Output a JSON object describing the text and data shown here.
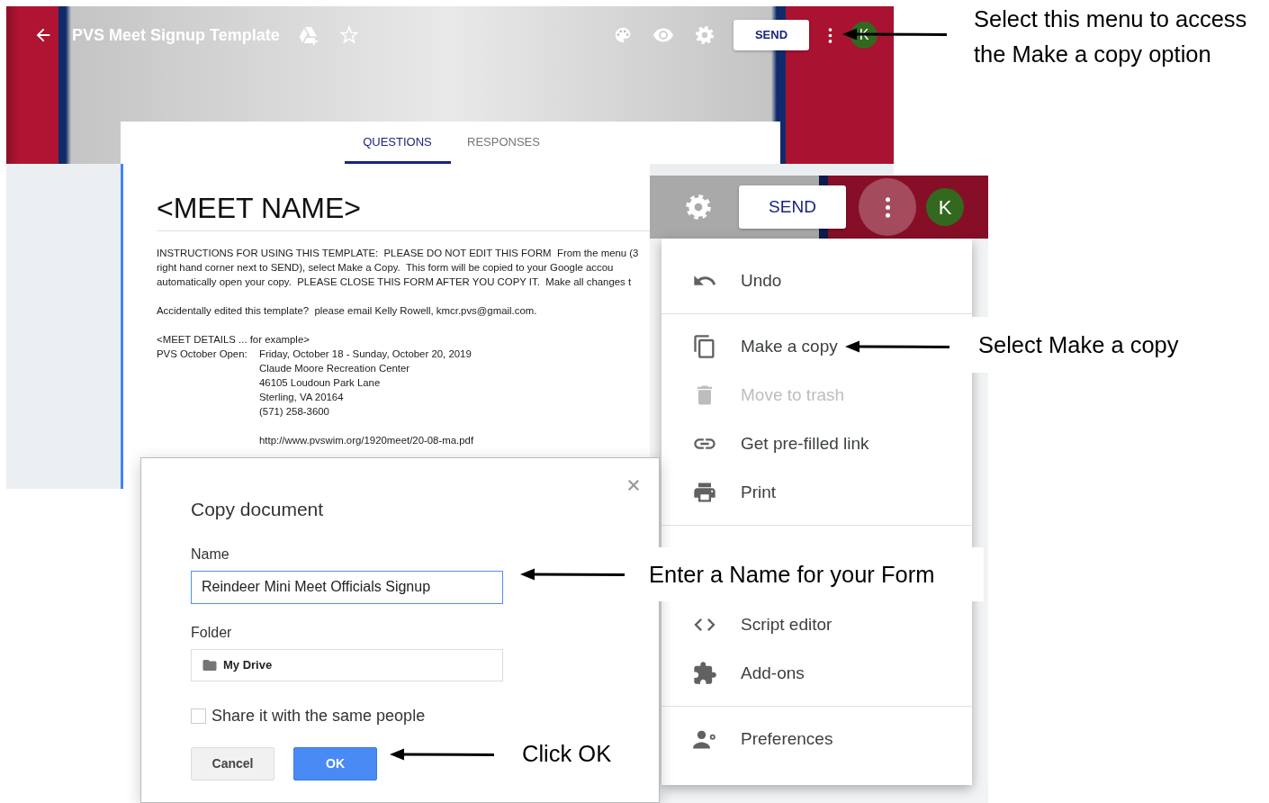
{
  "editor": {
    "title": "PVS Meet Signup Template",
    "send_button": "SEND",
    "avatar": "K",
    "tabs": [
      {
        "label": "QUESTIONS",
        "selected": true
      },
      {
        "label": "RESPONSES",
        "selected": false
      }
    ],
    "form": {
      "title": "<MEET NAME>",
      "instructions": [
        "INSTRUCTIONS FOR USING THIS TEMPLATE:  PLEASE DO NOT EDIT THIS FORM  From the menu (3",
        "right hand corner next to SEND), select Make a Copy.  This form will be copied to your Google accou",
        "automatically open your copy.  PLEASE CLOSE THIS FORM AFTER YOU COPY IT.  Make all changes t"
      ],
      "contact": "Accidentally edited this template?  please email Kelly Rowell, kmcr.pvs@gmail.com.",
      "details_heading": "<MEET DETAILS ... for example>",
      "details": [
        {
          "label": "PVS October Open:",
          "lines": [
            "Friday, October 18 - Sunday, October 20, 2019",
            "Claude Moore Recreation Center",
            "46105 Loudoun Park Lane",
            "Sterling, VA 20164",
            "(571) 258-3600"
          ]
        }
      ],
      "link": "http://www.pvswim.org/1920meet/20-08-ma.pdf"
    }
  },
  "menu_view": {
    "send_button": "SEND",
    "avatar": "K",
    "menu_button_active": true,
    "menu": {
      "groups": [
        {
          "items": [
            {
              "label": "Undo",
              "disabled": false
            }
          ]
        },
        {
          "items": [
            {
              "label": "Make a copy",
              "disabled": false
            },
            {
              "label": "Move to trash",
              "disabled": true
            },
            {
              "label": "Get pre-filled link",
              "disabled": false
            },
            {
              "label": "Print",
              "disabled": false
            }
          ]
        },
        {
          "items": [
            {
              "label": "Script editor",
              "disabled": false
            },
            {
              "label": "Add-ons",
              "disabled": false
            }
          ]
        },
        {
          "items": [
            {
              "label": "Preferences",
              "disabled": false
            }
          ]
        }
      ]
    }
  },
  "copy_dialog": {
    "title": "Copy document",
    "name_label": "Name",
    "name_value": "Reindeer Mini Meet Officials Signup",
    "folder_label": "Folder",
    "folder": "My Drive",
    "share_label": "Share it with the same people",
    "share_checked": false,
    "buttons": [
      {
        "label": "Cancel",
        "kind": "secondary"
      },
      {
        "label": "OK",
        "kind": "primary"
      }
    ]
  },
  "annotations": [
    {
      "text": "Select this menu to access the Make a copy option"
    },
    {
      "text": "Select Make a copy"
    },
    {
      "text": "Enter a Name for your Form"
    },
    {
      "text": "Click OK"
    }
  ]
}
